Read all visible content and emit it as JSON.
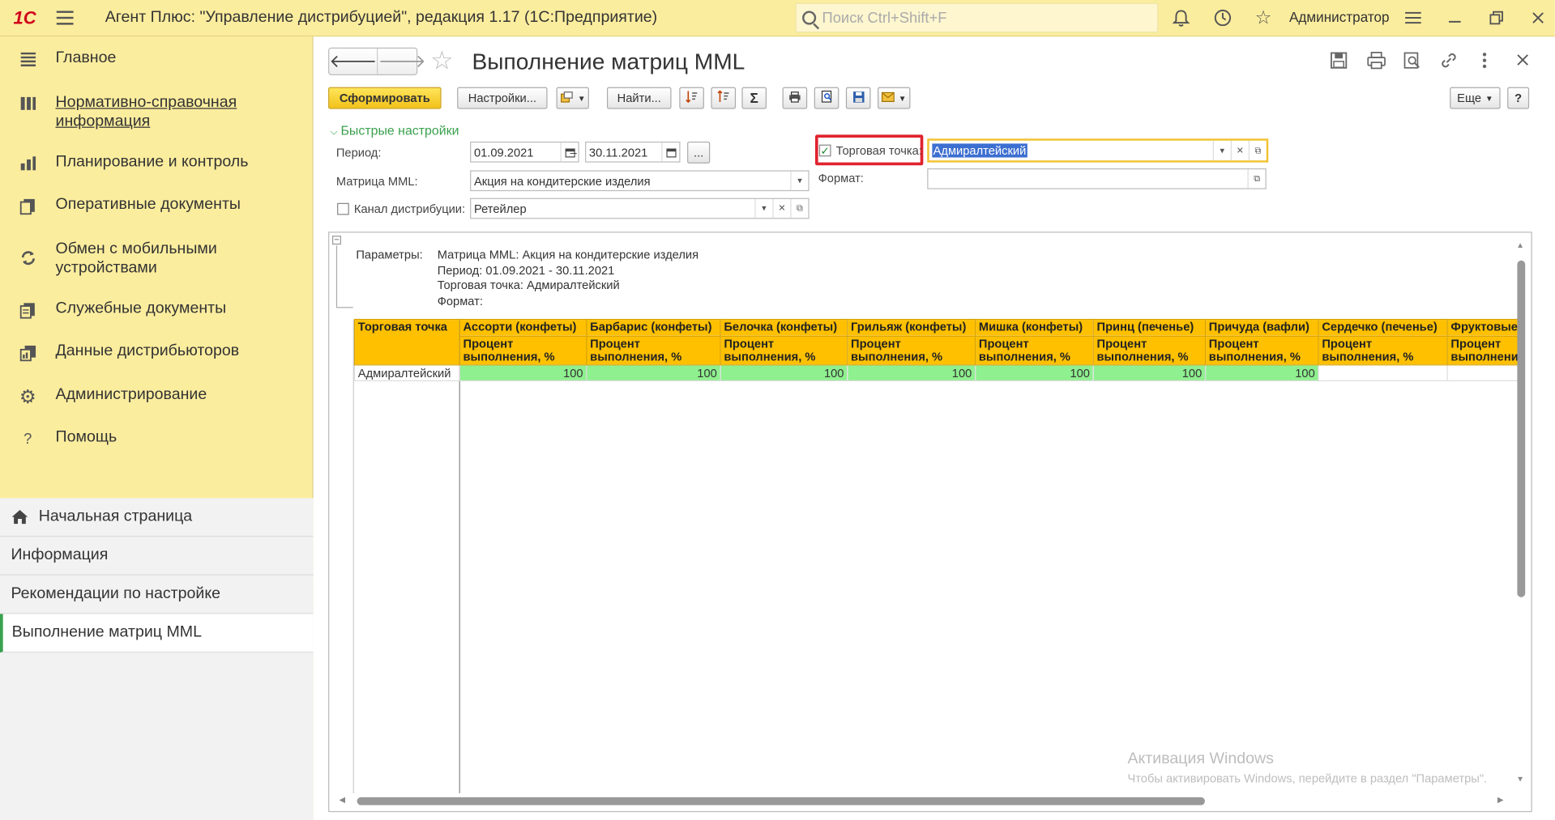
{
  "topbar": {
    "logo": "1С",
    "title": "Агент Плюс: \"Управление дистрибуцией\", редакция 1.17  (1С:Предприятие)",
    "search_placeholder": "Поиск Ctrl+Shift+F",
    "user": "Администратор"
  },
  "sidebar": {
    "items": [
      {
        "label": "Главное",
        "icon": "list-icon"
      },
      {
        "label": "Нормативно-справочная информация",
        "icon": "reference-icon"
      },
      {
        "label": "Планирование и контроль",
        "icon": "bar-chart-icon"
      },
      {
        "label": "Оперативные документы",
        "icon": "documents-icon"
      },
      {
        "label": "Обмен с мобильными устройствами",
        "icon": "sync-icon"
      },
      {
        "label": "Служебные документы",
        "icon": "service-docs-icon"
      },
      {
        "label": "Данные дистрибьюторов",
        "icon": "distributor-data-icon"
      },
      {
        "label": "Администрирование",
        "icon": "gear-icon"
      },
      {
        "label": "Помощь",
        "icon": "help-icon"
      }
    ],
    "open_windows": [
      {
        "label": "Начальная страница"
      },
      {
        "label": "Информация"
      },
      {
        "label": "Рекомендации по настройке"
      },
      {
        "label": "Выполнение матриц MML"
      }
    ]
  },
  "form": {
    "title": "Выполнение матриц MML",
    "toolbar": {
      "generate": "Сформировать",
      "settings": "Настройки...",
      "find": "Найти...",
      "more": "Еще",
      "help": "?"
    },
    "quick_settings": {
      "header": "Быстрые настройки",
      "period_label": "Период:",
      "period_from": "01.09.2021",
      "period_dash": "–",
      "period_to": "30.11.2021",
      "period_btn": "...",
      "matrix_label": "Матрица MML:",
      "matrix_value": "Акция на кондитерские изделия",
      "channel_label": "Канал дистрибуции:",
      "channel_value": "Ретейлер",
      "channel_checked": false,
      "outlet_label": "Торговая точка:",
      "outlet_value": "Адмиралтейский",
      "outlet_checked": true,
      "format_label": "Формат:",
      "format_value": ""
    }
  },
  "report": {
    "params_label": "Параметры:",
    "params": [
      "Матрица MML: Акция на кондитерские изделия",
      "Период: 01.09.2021 - 30.11.2021",
      "Торговая точка: Адмиралтейский",
      "Формат:"
    ],
    "row_header": "Торговая точка",
    "columns": [
      {
        "name": "Ассорти (конфеты)",
        "sub": "Процент выполнения, %"
      },
      {
        "name": "Барбарис (конфеты)",
        "sub": "Процент выполнения, %"
      },
      {
        "name": "Белочка (конфеты)",
        "sub": "Процент выполнения, %"
      },
      {
        "name": "Грильяж (конфеты)",
        "sub": "Процент выполнения, %"
      },
      {
        "name": "Мишка (конфеты)",
        "sub": "Процент выполнения, %"
      },
      {
        "name": "Принц (печенье)",
        "sub": "Процент выполнения, %"
      },
      {
        "name": "Причуда (вафли)",
        "sub": "Процент выполнения, %"
      },
      {
        "name": "Сердечко (печенье)",
        "sub": "Процент выполнения, %"
      },
      {
        "name": "Фруктовые",
        "sub": "Процент выполнени"
      }
    ],
    "rows": [
      {
        "name": "Адмиралтейский",
        "values": [
          "100",
          "100",
          "100",
          "100",
          "100",
          "100",
          "100",
          "",
          ""
        ]
      }
    ]
  },
  "watermark": {
    "line1": "Активация Windows",
    "line2": "Чтобы активировать Windows, перейдите в раздел \"Параметры\"."
  },
  "colors": {
    "sidebar_bg": "#fbed9e",
    "header_fill": "#ffc000",
    "value_fill": "#8ef08e",
    "accent_green": "#3aa14e",
    "highlight_red": "#e0232e"
  }
}
